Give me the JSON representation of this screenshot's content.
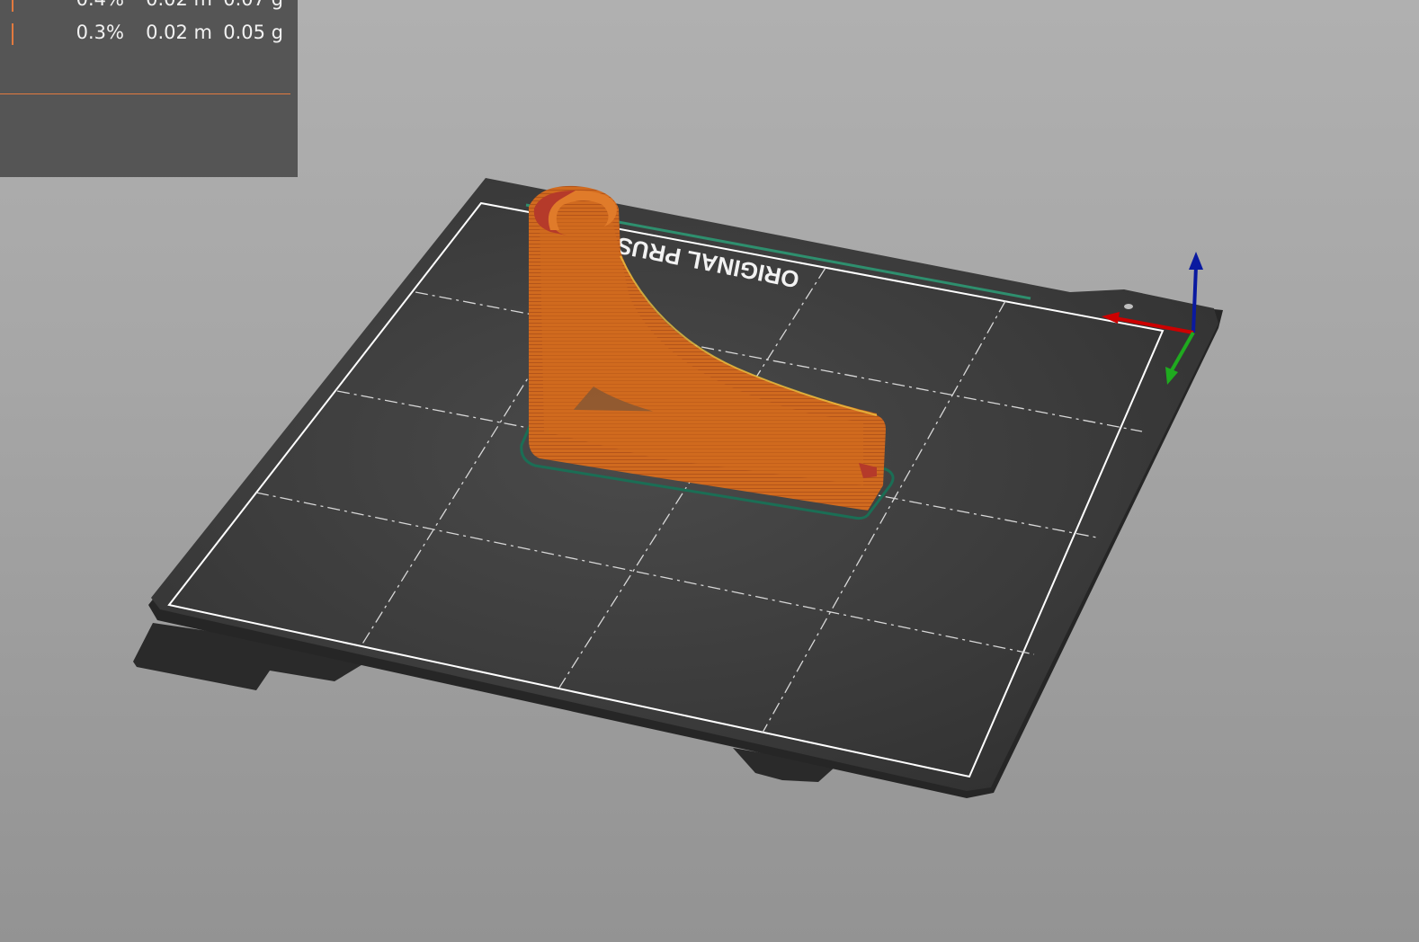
{
  "viewport": {
    "bed_label": "ORIGINAL PRUSA MINI"
  },
  "legend": {
    "rows": [
      {
        "percent": "0.4%",
        "length": "0.02 m",
        "weight": "0.07 g"
      },
      {
        "percent": "0.3%",
        "length": "0.02 m",
        "weight": "0.05 g"
      }
    ],
    "accent_color": "#e27a3f"
  },
  "colors": {
    "background": "#a6a6a6",
    "bed_surface": "#3a3a3a",
    "bed_border": "#ffffff",
    "print_orange": "#d2691e",
    "skirt_green": "#1f7a5c",
    "axis_x": "#cc0000",
    "axis_y": "#1faa1f",
    "axis_z": "#0a1aa0"
  }
}
